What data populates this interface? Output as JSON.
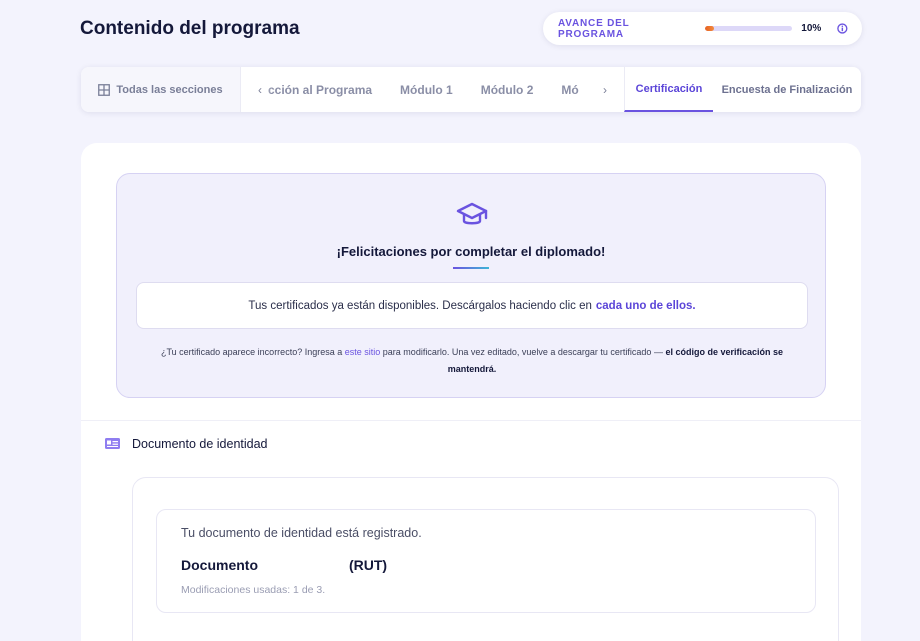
{
  "page": {
    "title": "Contenido del programa"
  },
  "progress": {
    "label": "AVANCE DEL PROGRAMA",
    "percent": 10,
    "value_text": "10%"
  },
  "tabs": {
    "all_sections": "Todas las secciones",
    "scroll_items": [
      "cción al Programa",
      "Módulo 1",
      "Módulo 2",
      "Mó"
    ],
    "active": "Certificación",
    "survey": "Encuesta de Finalización"
  },
  "certificate": {
    "title": "¡Felicitaciones por completar el diplomado!",
    "available_text": "Tus certificados ya están disponibles. Descárgalos haciendo clic en",
    "available_link": "cada uno de ellos.",
    "note_part1": "¿Tu certificado aparece incorrecto? Ingresa a",
    "note_link": "este sitio",
    "note_part2": "para modificarlo. Una vez editado, vuelve a descargar tu certificado —",
    "note_bold": "el código de verificación se mantendrá."
  },
  "identity": {
    "section_title": "Documento de identidad",
    "registered_text": "Tu documento de identidad está registrado.",
    "document_label": "Documento",
    "document_type": "(RUT)",
    "modifications": "Modificaciones usadas: 1 de 3."
  },
  "colors": {
    "accent": "#6a53e0",
    "progress_fill": "#e7611f",
    "background": "#f3f3fd"
  }
}
